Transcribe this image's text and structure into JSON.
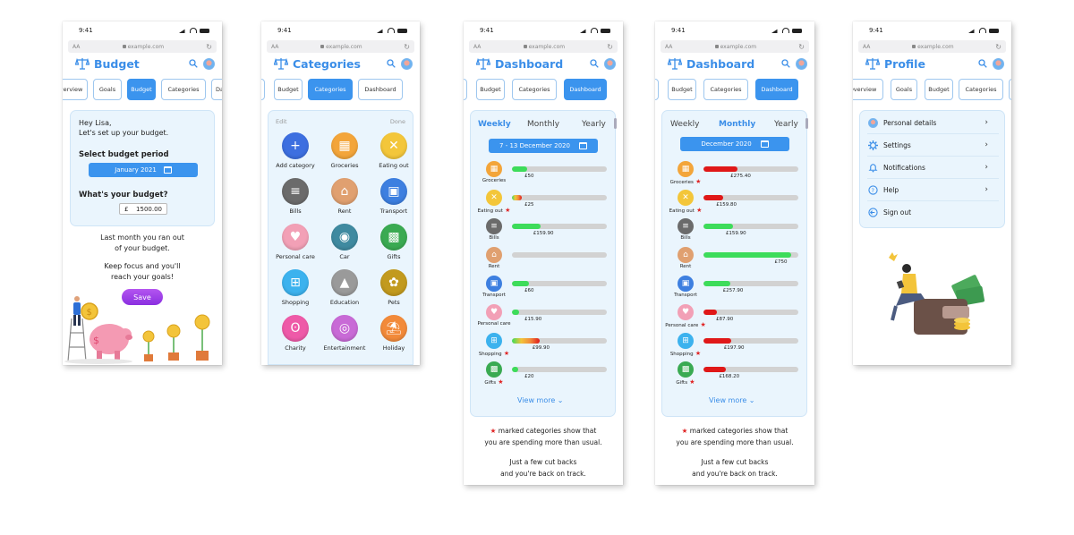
{
  "status": {
    "time": "9:41"
  },
  "browser": {
    "aa": "AA",
    "url": "example.com",
    "reload": "↻"
  },
  "budget_screen": {
    "title": "Budget",
    "tabs": [
      "Overview",
      "Goals",
      "Budget",
      "Categories",
      "Dashboard"
    ],
    "active_tab": "Budget",
    "greeting_line1": "Hey Lisa,",
    "greeting_line2": "Let's set up your budget.",
    "period_label": "Select budget period",
    "period_value": "January 2021",
    "budget_label": "What's your budget?",
    "currency": "£",
    "amount": "1500.00",
    "msg1_line1": "Last month you ran out",
    "msg1_line2": "of your budget.",
    "msg2_line1": "Keep focus and you'll",
    "msg2_line2": "reach your goals!",
    "save_label": "Save"
  },
  "categories_screen": {
    "title": "Categories",
    "tabs": [
      "Budget",
      "Categories",
      "Dashboard"
    ],
    "active_tab": "Categories",
    "edit_label": "Edit",
    "done_label": "Done",
    "items": [
      {
        "label": "Add category",
        "icon": "plus-icon",
        "color": "#3d6fe0",
        "glyph": "+"
      },
      {
        "label": "Groceries",
        "icon": "grocery-bag-icon",
        "color": "#f3a53a",
        "glyph": "▦"
      },
      {
        "label": "Eating out",
        "icon": "cutlery-icon",
        "color": "#f3c63a",
        "glyph": "✕"
      },
      {
        "label": "Bills",
        "icon": "receipt-icon",
        "color": "#6b6b6b",
        "glyph": "≡"
      },
      {
        "label": "Rent",
        "icon": "house-icon",
        "color": "#e0a070",
        "glyph": "⌂"
      },
      {
        "label": "Transport",
        "icon": "train-icon",
        "color": "#3d7fe0",
        "glyph": "▣"
      },
      {
        "label": "Personal care",
        "icon": "heart-icon",
        "color": "#f2a0b6",
        "glyph": "♥"
      },
      {
        "label": "Car",
        "icon": "car-icon",
        "color": "#3f8aa0",
        "glyph": "◉"
      },
      {
        "label": "Gifts",
        "icon": "gift-icon",
        "color": "#3aaa52",
        "glyph": "▩"
      },
      {
        "label": "Shopping",
        "icon": "cart-icon",
        "color": "#3cb2ee",
        "glyph": "⊞"
      },
      {
        "label": "Education",
        "icon": "graduation-cap-icon",
        "color": "#9a9a9a",
        "glyph": "▲"
      },
      {
        "label": "Pets",
        "icon": "paw-icon",
        "color": "#c29a1e",
        "glyph": "✿"
      },
      {
        "label": "Charity",
        "icon": "ribbon-icon",
        "color": "#ee5aa8",
        "glyph": "ʘ"
      },
      {
        "label": "Entertainment",
        "icon": "ticket-icon",
        "color": "#c86ad6",
        "glyph": "◎"
      },
      {
        "label": "Holiday",
        "icon": "beach-icon",
        "color": "#f28a3a",
        "glyph": "⛱"
      }
    ]
  },
  "dashboard_weekly": {
    "title": "Dashboard",
    "tabs": [
      "Budget",
      "Categories",
      "Dashboard"
    ],
    "active_tab": "Dashboard",
    "periods": [
      "Weekly",
      "Monthly",
      "Yearly"
    ],
    "selected_period": "Weekly",
    "date_range": "7 - 13 December 2020",
    "rows": [
      {
        "name": "Groceries",
        "star": false,
        "amount": "£50",
        "fill": 0.16,
        "color": "#3ddc5a"
      },
      {
        "name": "Eating out",
        "star": true,
        "amount": "£25",
        "fill": 0.1,
        "color": "gradient"
      },
      {
        "name": "Bills",
        "star": false,
        "amount": "£159.90",
        "fill": 0.3,
        "color": "#3ddc5a"
      },
      {
        "name": "Rent",
        "star": false,
        "amount": "",
        "fill": 0,
        "color": "#3ddc5a"
      },
      {
        "name": "Transport",
        "star": false,
        "amount": "£60",
        "fill": 0.18,
        "color": "#3ddc5a"
      },
      {
        "name": "Personal care",
        "star": false,
        "amount": "£15.90",
        "fill": 0.08,
        "color": "#3ddc5a"
      },
      {
        "name": "Shopping",
        "star": true,
        "amount": "£99.90",
        "fill": 0.29,
        "color": "gradient"
      },
      {
        "name": "Gifts",
        "star": true,
        "amount": "£20",
        "fill": 0.07,
        "color": "#3ddc5a"
      }
    ],
    "view_more": "View more",
    "note_line1": "marked categories show that",
    "note_line2": "you are spending more than usual.",
    "note_line3": "Just a few cut backs",
    "note_line4": "and you're back on track."
  },
  "dashboard_monthly": {
    "title": "Dashboard",
    "tabs": [
      "Budget",
      "Categories",
      "Dashboard"
    ],
    "active_tab": "Dashboard",
    "periods": [
      "Weekly",
      "Monthly",
      "Yearly"
    ],
    "selected_period": "Monthly",
    "date_range": "December 2020",
    "rows": [
      {
        "name": "Groceries",
        "star": true,
        "amount": "£275.40",
        "fill": 0.36,
        "color": "#e01818"
      },
      {
        "name": "Eating out",
        "star": true,
        "amount": "£159.80",
        "fill": 0.21,
        "color": "#e01818"
      },
      {
        "name": "Bills",
        "star": false,
        "amount": "£159.90",
        "fill": 0.31,
        "color": "#3ddc5a"
      },
      {
        "name": "Rent",
        "star": false,
        "amount": "£750",
        "fill": 0.92,
        "color": "#3ddc5a"
      },
      {
        "name": "Transport",
        "star": false,
        "amount": "£257.90",
        "fill": 0.28,
        "color": "#3ddc5a"
      },
      {
        "name": "Personal care",
        "star": true,
        "amount": "£87.90",
        "fill": 0.14,
        "color": "#e01818"
      },
      {
        "name": "Shopping",
        "star": true,
        "amount": "£197.90",
        "fill": 0.29,
        "color": "#e01818"
      },
      {
        "name": "Gifts",
        "star": true,
        "amount": "£168.20",
        "fill": 0.24,
        "color": "#e01818"
      }
    ],
    "view_more": "View more",
    "note_line1": "marked categories show that",
    "note_line2": "you are spending more than usual.",
    "note_line3": "Just a few cut backs",
    "note_line4": "and you're back on track."
  },
  "profile_screen": {
    "title": "Profile",
    "tabs": [
      "Overview",
      "Goals",
      "Budget",
      "Categories"
    ],
    "active_tab": "",
    "items": [
      {
        "label": "Personal details",
        "icon": "avatar-icon"
      },
      {
        "label": "Settings",
        "icon": "gear-icon"
      },
      {
        "label": "Notifications",
        "icon": "bell-icon"
      },
      {
        "label": "Help",
        "icon": "help-icon"
      },
      {
        "label": "Sign out",
        "icon": "sign-out-icon"
      }
    ]
  },
  "colors": {
    "accent": "#3b94ee",
    "brand_text": "#3b8ee8",
    "card_bg": "#eaf5fd",
    "over_budget": "#e01818",
    "on_track": "#3ddc5a",
    "save_button": "#9b3fe8"
  }
}
